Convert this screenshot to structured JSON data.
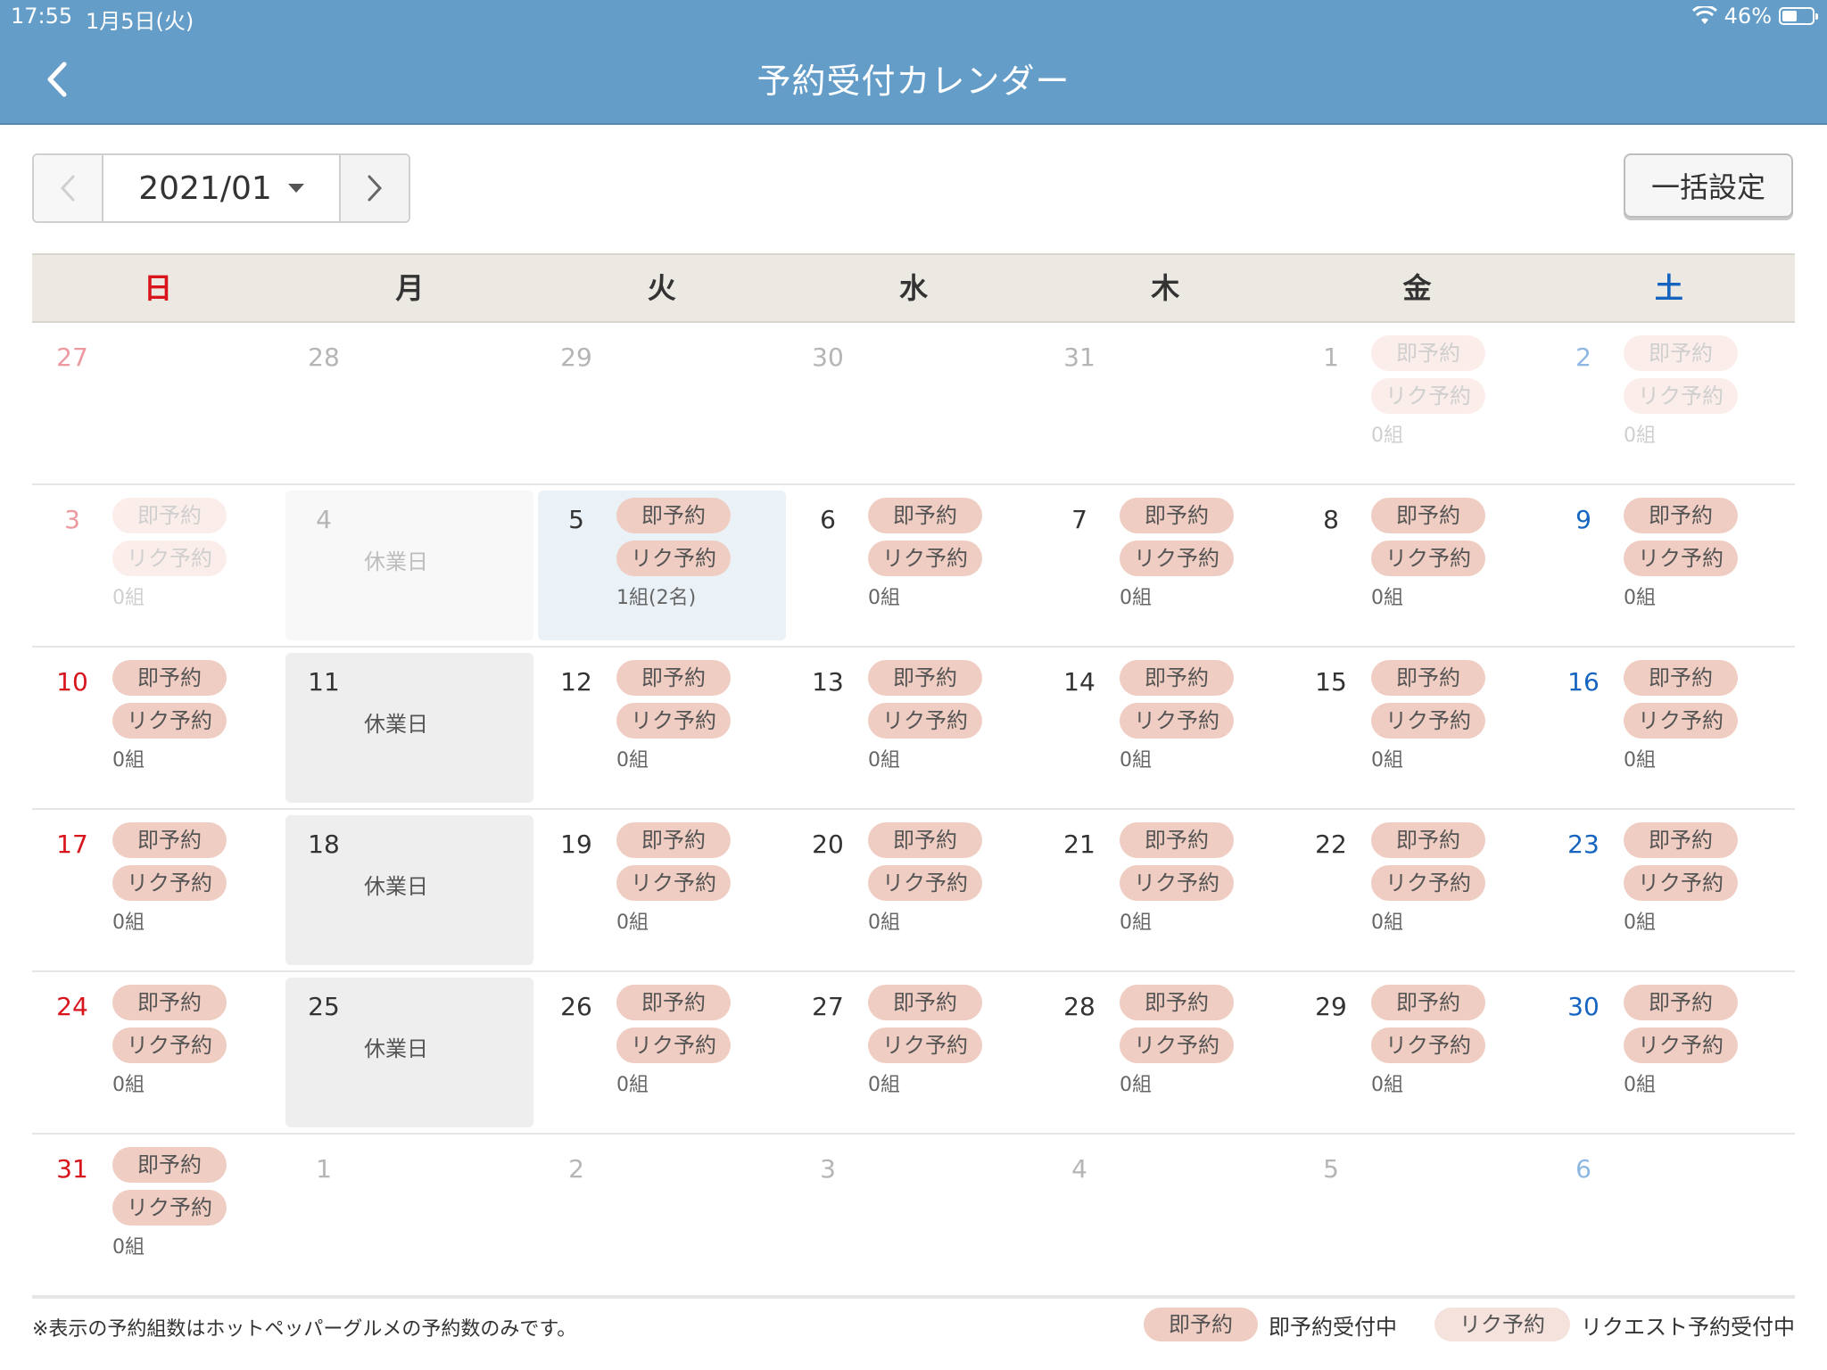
{
  "status_bar": {
    "time": "17:55",
    "date": "1月5日(火)",
    "battery": "46%"
  },
  "header": {
    "title": "予約受付カレンダー"
  },
  "nav": {
    "month": "2021/01",
    "bulk_button": "一括設定"
  },
  "weekdays": [
    "日",
    "月",
    "火",
    "水",
    "木",
    "金",
    "土"
  ],
  "labels": {
    "instant": "即予約",
    "request": "リク予約",
    "closed": "休業日"
  },
  "weeks": [
    [
      {
        "day": "27",
        "other": true
      },
      {
        "day": "28",
        "other": true
      },
      {
        "day": "29",
        "other": true
      },
      {
        "day": "30",
        "other": true
      },
      {
        "day": "31",
        "other": true
      },
      {
        "day": "1",
        "faded": true,
        "count": "0組"
      },
      {
        "day": "2",
        "faded": true,
        "count": "0組"
      }
    ],
    [
      {
        "day": "3",
        "faded": true,
        "count": "0組"
      },
      {
        "day": "4",
        "faded": true,
        "closed": true
      },
      {
        "day": "5",
        "today": true,
        "count": "1組(2名)"
      },
      {
        "day": "6",
        "count": "0組"
      },
      {
        "day": "7",
        "count": "0組"
      },
      {
        "day": "8",
        "count": "0組"
      },
      {
        "day": "9",
        "count": "0組"
      }
    ],
    [
      {
        "day": "10",
        "count": "0組"
      },
      {
        "day": "11",
        "closed": true
      },
      {
        "day": "12",
        "count": "0組"
      },
      {
        "day": "13",
        "count": "0組"
      },
      {
        "day": "14",
        "count": "0組"
      },
      {
        "day": "15",
        "count": "0組"
      },
      {
        "day": "16",
        "count": "0組"
      }
    ],
    [
      {
        "day": "17",
        "count": "0組"
      },
      {
        "day": "18",
        "closed": true
      },
      {
        "day": "19",
        "count": "0組"
      },
      {
        "day": "20",
        "count": "0組"
      },
      {
        "day": "21",
        "count": "0組"
      },
      {
        "day": "22",
        "count": "0組"
      },
      {
        "day": "23",
        "count": "0組"
      }
    ],
    [
      {
        "day": "24",
        "count": "0組"
      },
      {
        "day": "25",
        "closed": true
      },
      {
        "day": "26",
        "count": "0組"
      },
      {
        "day": "27",
        "count": "0組"
      },
      {
        "day": "28",
        "count": "0組"
      },
      {
        "day": "29",
        "count": "0組"
      },
      {
        "day": "30",
        "count": "0組"
      }
    ],
    [
      {
        "day": "31",
        "count": "0組"
      },
      {
        "day": "1",
        "other": true
      },
      {
        "day": "2",
        "other": true
      },
      {
        "day": "3",
        "other": true
      },
      {
        "day": "4",
        "other": true
      },
      {
        "day": "5",
        "other": true
      },
      {
        "day": "6",
        "other": true
      }
    ]
  ],
  "footer": {
    "note": "※表示の予約組数はホットペッパーグルメの予約数のみです。",
    "legend_instant_pill": "即予約",
    "legend_instant_text": "即予約受付中",
    "legend_request_pill": "リク予約",
    "legend_request_text": "リクエスト予約受付中"
  },
  "colors": {
    "header": "#659dc9",
    "pill": "#f0cdc2",
    "sunday": "#d8141d",
    "saturday": "#1565c0",
    "today_bg": "#eaf2f7",
    "closed_bg": "#eeeeee"
  },
  "icons": {
    "back": "chevron-left-icon",
    "prev": "chevron-left-icon",
    "next": "chevron-right-icon",
    "dropdown": "caret-down-icon",
    "wifi": "wifi-icon",
    "battery": "battery-icon"
  }
}
